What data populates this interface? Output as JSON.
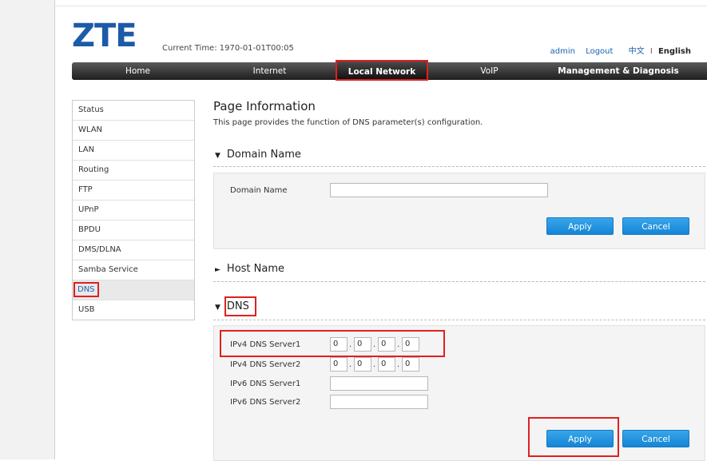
{
  "header": {
    "logo": "ZTE",
    "current_time": "Current Time: 1970-01-01T00:05",
    "user": "admin",
    "logout": "Logout",
    "lang_cn": "中文",
    "lang_sep": "I",
    "lang_en": "English"
  },
  "nav": {
    "items": [
      "Home",
      "Internet",
      "Local Network",
      "VoIP",
      "Management & Diagnosis"
    ],
    "active": "Local Network"
  },
  "sidebar": {
    "items": [
      "Status",
      "WLAN",
      "LAN",
      "Routing",
      "FTP",
      "UPnP",
      "BPDU",
      "DMS/DLNA",
      "Samba Service",
      "DNS",
      "USB"
    ],
    "active": "DNS"
  },
  "page": {
    "title": "Page Information",
    "description": "This page provides the function of DNS parameter(s) configuration."
  },
  "domain_section": {
    "heading": "Domain Name",
    "field_label": "Domain Name",
    "field_value": "",
    "apply": "Apply",
    "cancel": "Cancel"
  },
  "host_section": {
    "heading": "Host Name"
  },
  "dns_section": {
    "heading": "DNS",
    "ipv4_server1_label": "IPv4 DNS Server1",
    "ipv4_server1": [
      "0",
      "0",
      "0",
      "0"
    ],
    "ipv4_server2_label": "IPv4 DNS Server2",
    "ipv4_server2": [
      "0",
      "0",
      "0",
      "0"
    ],
    "ipv6_server1_label": "IPv6 DNS Server1",
    "ipv6_server1": "",
    "ipv6_server2_label": "IPv6 DNS Server2",
    "ipv6_server2": "",
    "apply": "Apply",
    "cancel": "Cancel"
  },
  "colors": {
    "brand_blue": "#1d5aa8",
    "button_blue": "#1585d6",
    "highlight_red": "#e02020"
  }
}
